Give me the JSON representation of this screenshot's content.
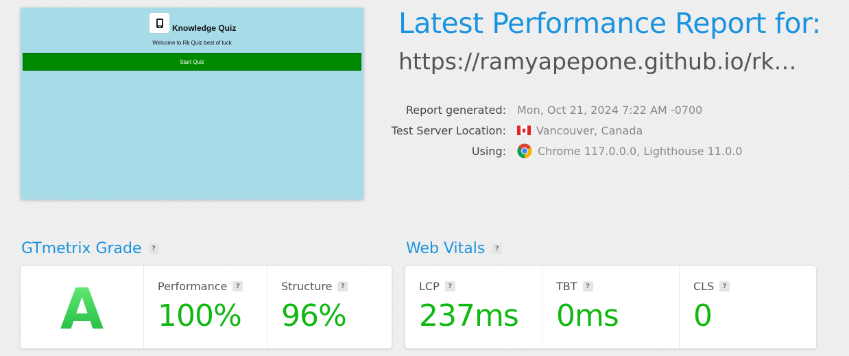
{
  "thumbnail": {
    "title": "Knowledge Quiz",
    "welcome": "Welcome to Rk Quiz best of luck",
    "start_button": "Start Quiz"
  },
  "report": {
    "title": "Latest Performance Report for:",
    "url": "https://ramyapepone.github.io/rk-kno..."
  },
  "meta": {
    "generated_label": "Report generated:",
    "generated_value": "Mon, Oct 21, 2024 7:22 AM -0700",
    "location_label": "Test Server Location:",
    "location_value": "Vancouver, Canada",
    "using_label": "Using:",
    "using_value": "Chrome 117.0.0.0, Lighthouse 11.0.0"
  },
  "grade_section": {
    "title": "GTmetrix Grade",
    "help": "?",
    "grade": "A",
    "performance_label": "Performance",
    "performance_value": "100%",
    "structure_label": "Structure",
    "structure_value": "96%"
  },
  "vitals_section": {
    "title": "Web Vitals",
    "help": "?",
    "lcp_label": "LCP",
    "lcp_value": "237ms",
    "tbt_label": "TBT",
    "tbt_value": "0ms",
    "cls_label": "CLS",
    "cls_value": "0"
  },
  "colors": {
    "accent": "#1a93e0",
    "good": "#11b811",
    "thumb_bg": "#a8dbe8",
    "thumb_button": "#008a00"
  },
  "icons": {
    "flag": "canada-flag-icon",
    "browser": "chrome-icon",
    "thumb_logo": "phone-icon"
  }
}
